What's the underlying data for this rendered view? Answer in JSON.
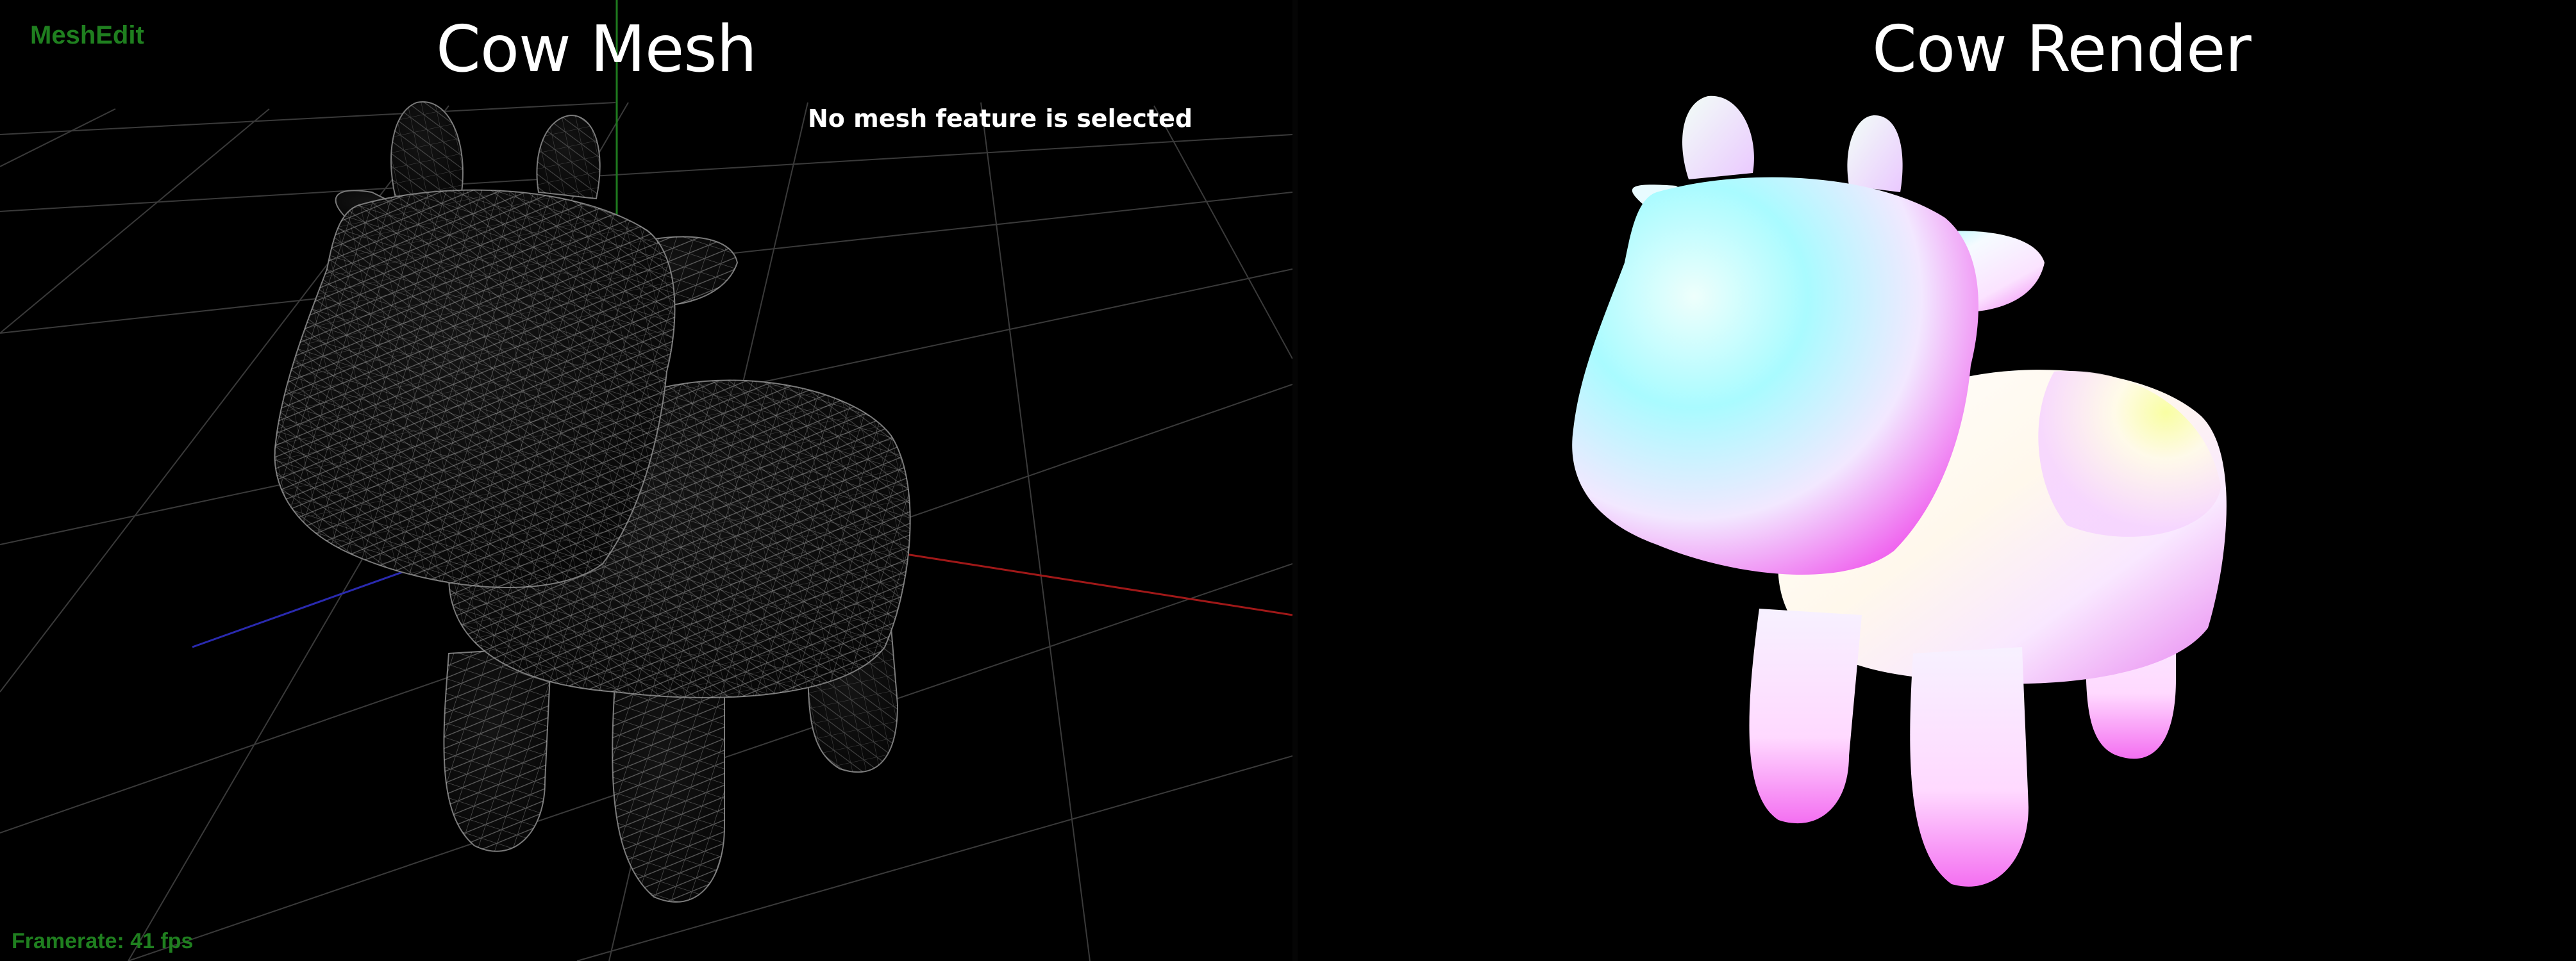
{
  "app": {
    "name": "MeshEdit"
  },
  "left_view": {
    "title": "Cow Mesh",
    "selection_status": "No mesh feature is selected",
    "framerate_label": "Framerate:",
    "framerate_value": "41 fps"
  },
  "right_view": {
    "title": "Cow Render"
  },
  "colors": {
    "background": "#000000",
    "hud_text": "#1f7f1f",
    "title_text": "#ffffff",
    "grid": "#3a3a3a",
    "axis_x": "#a01818",
    "axis_y": "#1e7a1e",
    "axis_z": "#2a2ab0",
    "wireframe": "#bfbfbf"
  }
}
